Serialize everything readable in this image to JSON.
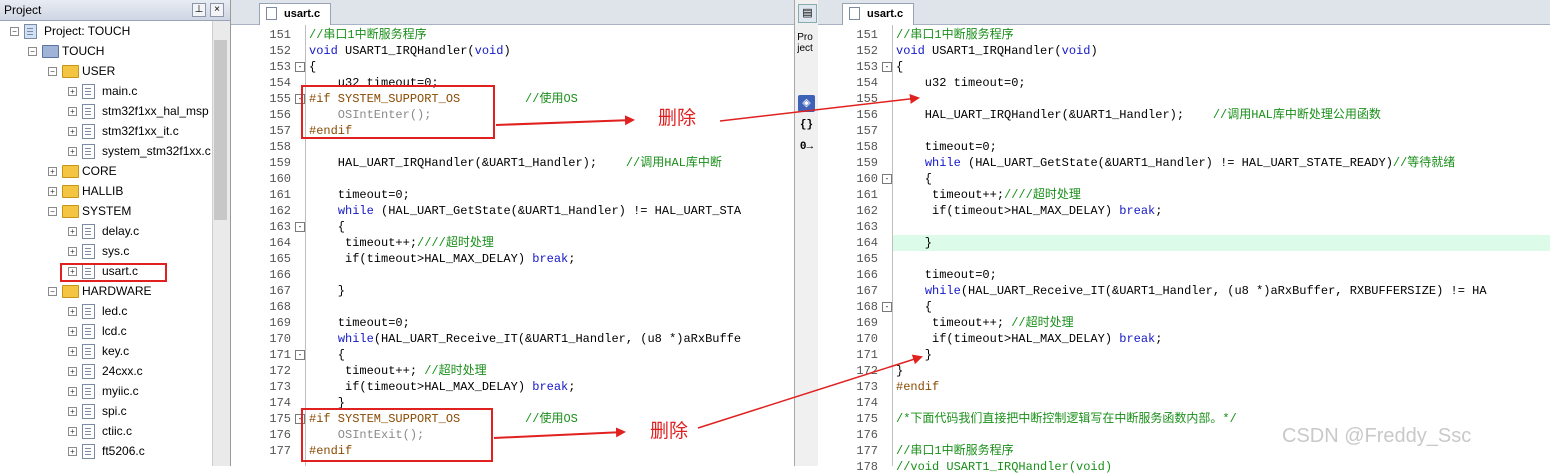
{
  "project_panel": {
    "title": "Project",
    "pin_icon": "pin-icon",
    "close_icon": "close-icon",
    "tree": [
      {
        "label": "Project: TOUCH",
        "type": "project",
        "indent": 0
      },
      {
        "label": "TOUCH",
        "type": "target",
        "indent": 1
      },
      {
        "label": "USER",
        "type": "folder",
        "indent": 2,
        "expanded": true
      },
      {
        "label": "main.c",
        "type": "file",
        "indent": 3
      },
      {
        "label": "stm32f1xx_hal_msp",
        "type": "file",
        "indent": 3
      },
      {
        "label": "stm32f1xx_it.c",
        "type": "file",
        "indent": 3
      },
      {
        "label": "system_stm32f1xx.c",
        "type": "file",
        "indent": 3
      },
      {
        "label": "CORE",
        "type": "folder",
        "indent": 2,
        "expanded": false
      },
      {
        "label": "HALLIB",
        "type": "folder",
        "indent": 2,
        "expanded": false
      },
      {
        "label": "SYSTEM",
        "type": "folder",
        "indent": 2,
        "expanded": true
      },
      {
        "label": "delay.c",
        "type": "file",
        "indent": 3
      },
      {
        "label": "sys.c",
        "type": "file",
        "indent": 3
      },
      {
        "label": "usart.c",
        "type": "file",
        "indent": 3,
        "highlight": true
      },
      {
        "label": "HARDWARE",
        "type": "folder",
        "indent": 2,
        "expanded": true
      },
      {
        "label": "led.c",
        "type": "file",
        "indent": 3
      },
      {
        "label": "lcd.c",
        "type": "file",
        "indent": 3
      },
      {
        "label": "key.c",
        "type": "file",
        "indent": 3
      },
      {
        "label": "24cxx.c",
        "type": "file",
        "indent": 3
      },
      {
        "label": "myiic.c",
        "type": "file",
        "indent": 3
      },
      {
        "label": "spi.c",
        "type": "file",
        "indent": 3
      },
      {
        "label": "ctiic.c",
        "type": "file",
        "indent": 3
      },
      {
        "label": "ft5206.c",
        "type": "file",
        "indent": 3
      }
    ]
  },
  "left_editor": {
    "tab": "usart.c",
    "lines": [
      {
        "n": "151",
        "text": "//串口1中断服务程序",
        "cls": "cm"
      },
      {
        "n": "152",
        "text": "void USART1_IRQHandler(void)",
        "cls": ""
      },
      {
        "n": "153",
        "text": "{",
        "cls": "",
        "fold": "-"
      },
      {
        "n": "154",
        "text": "    u32 timeout=0;",
        "cls": ""
      },
      {
        "n": "155",
        "text": "#if SYSTEM_SUPPORT_OS         //使用OS",
        "cls": "pp",
        "fold": "-"
      },
      {
        "n": "156",
        "text": "    OSIntEnter();",
        "cls": "dim"
      },
      {
        "n": "157",
        "text": "#endif",
        "cls": "pp"
      },
      {
        "n": "158",
        "text": "",
        "cls": ""
      },
      {
        "n": "159",
        "text": "    HAL_UART_IRQHandler(&UART1_Handler);    //调用HAL库中断",
        "cls": ""
      },
      {
        "n": "160",
        "text": "",
        "cls": ""
      },
      {
        "n": "161",
        "text": "    timeout=0;",
        "cls": ""
      },
      {
        "n": "162",
        "text": "    while (HAL_UART_GetState(&UART1_Handler) != HAL_UART_STA",
        "cls": ""
      },
      {
        "n": "163",
        "text": "    {",
        "cls": "",
        "fold": "-"
      },
      {
        "n": "164",
        "text": "     timeout++;////超时处理",
        "cls": ""
      },
      {
        "n": "165",
        "text": "     if(timeout>HAL_MAX_DELAY) break;",
        "cls": ""
      },
      {
        "n": "166",
        "text": "",
        "cls": ""
      },
      {
        "n": "167",
        "text": "    }",
        "cls": ""
      },
      {
        "n": "168",
        "text": "",
        "cls": ""
      },
      {
        "n": "169",
        "text": "    timeout=0;",
        "cls": ""
      },
      {
        "n": "170",
        "text": "    while(HAL_UART_Receive_IT(&UART1_Handler, (u8 *)aRxBuffe",
        "cls": ""
      },
      {
        "n": "171",
        "text": "    {",
        "cls": "",
        "fold": "-"
      },
      {
        "n": "172",
        "text": "     timeout++; //超时处理",
        "cls": ""
      },
      {
        "n": "173",
        "text": "     if(timeout>HAL_MAX_DELAY) break;",
        "cls": ""
      },
      {
        "n": "174",
        "text": "    }",
        "cls": ""
      },
      {
        "n": "175",
        "text": "#if SYSTEM_SUPPORT_OS         //使用OS",
        "cls": "pp",
        "fold": "-"
      },
      {
        "n": "176",
        "text": "    OSIntExit();",
        "cls": "dim"
      },
      {
        "n": "177",
        "text": "#endif",
        "cls": "pp"
      }
    ]
  },
  "middle_toolbar": {
    "label": "Project",
    "buttons": [
      "books-icon",
      "{}",
      "0→"
    ]
  },
  "right_editor": {
    "tab": "usart.c",
    "lines": [
      {
        "n": "151",
        "text": "//串口1中断服务程序",
        "cls": "cm"
      },
      {
        "n": "152",
        "text": "void USART1_IRQHandler(void)",
        "cls": ""
      },
      {
        "n": "153",
        "text": "{",
        "cls": "",
        "fold": "-"
      },
      {
        "n": "154",
        "text": "    u32 timeout=0;",
        "cls": ""
      },
      {
        "n": "155",
        "text": "",
        "cls": ""
      },
      {
        "n": "156",
        "text": "    HAL_UART_IRQHandler(&UART1_Handler);    //调用HAL库中断处理公用函数",
        "cls": ""
      },
      {
        "n": "157",
        "text": "",
        "cls": ""
      },
      {
        "n": "158",
        "text": "    timeout=0;",
        "cls": ""
      },
      {
        "n": "159",
        "text": "    while (HAL_UART_GetState(&UART1_Handler) != HAL_UART_STATE_READY)//等待就绪",
        "cls": ""
      },
      {
        "n": "160",
        "text": "    {",
        "cls": "",
        "fold": "-"
      },
      {
        "n": "161",
        "text": "     timeout++;////超时处理",
        "cls": ""
      },
      {
        "n": "162",
        "text": "     if(timeout>HAL_MAX_DELAY) break;",
        "cls": ""
      },
      {
        "n": "163",
        "text": "",
        "cls": ""
      },
      {
        "n": "164",
        "text": "    }",
        "cls": "",
        "hl": true
      },
      {
        "n": "165",
        "text": "",
        "cls": ""
      },
      {
        "n": "166",
        "text": "    timeout=0;",
        "cls": ""
      },
      {
        "n": "167",
        "text": "    while(HAL_UART_Receive_IT(&UART1_Handler, (u8 *)aRxBuffer, RXBUFFERSIZE) != HA",
        "cls": ""
      },
      {
        "n": "168",
        "text": "    {",
        "cls": "",
        "fold": "-"
      },
      {
        "n": "169",
        "text": "     timeout++; //超时处理",
        "cls": ""
      },
      {
        "n": "170",
        "text": "     if(timeout>HAL_MAX_DELAY) break;",
        "cls": ""
      },
      {
        "n": "171",
        "text": "    }",
        "cls": ""
      },
      {
        "n": "172",
        "text": "}",
        "cls": ""
      },
      {
        "n": "173",
        "text": "#endif",
        "cls": "pp"
      },
      {
        "n": "174",
        "text": "",
        "cls": ""
      },
      {
        "n": "175",
        "text": "/*下面代码我们直接把中断控制逻辑写在中断服务函数内部。*/",
        "cls": "cm"
      },
      {
        "n": "176",
        "text": "",
        "cls": ""
      },
      {
        "n": "177",
        "text": "//串口1中断服务程序",
        "cls": "cm"
      },
      {
        "n": "178",
        "text": "//void USART1_IRQHandler(void)",
        "cls": "cm"
      }
    ]
  },
  "annotations": {
    "delete_label_1": "删除",
    "delete_label_2": "删除",
    "color": "#e0211f"
  },
  "watermark": "CSDN @Freddy_Ssc"
}
